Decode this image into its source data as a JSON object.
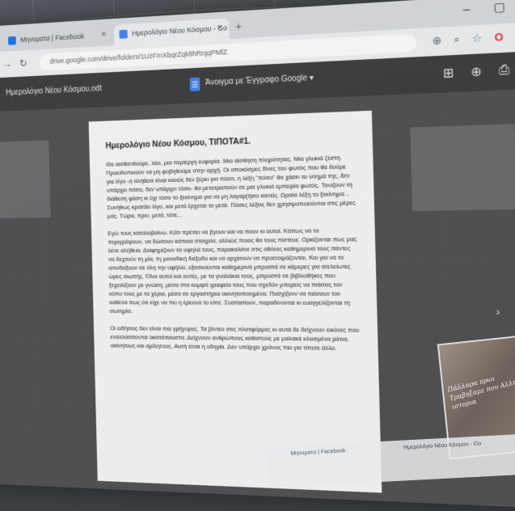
{
  "tabs": [
    {
      "label": "Μηνυματα | Facebook",
      "color": "#1877f2"
    },
    {
      "label": "Ημερολόγιο Νέου Κόσμου - Go",
      "color": "#4285f4"
    }
  ],
  "new_tab": "+",
  "window_controls": {
    "minimize": "–",
    "maximize": "▢",
    "close": "×"
  },
  "address_bar": {
    "url": "drive.google.com/drive/folders/1UzFmXbqrZqk8hRnjqPMlZ"
  },
  "viewer": {
    "back_icon": "←",
    "doc_name": "Ημερολόγιο Νέου Κόσμου.odt",
    "open_with": "Άνοιγμα με Έγγραφο Google",
    "open_with_arrow": "▾"
  },
  "document": {
    "title": "Ημερολόγιο Νέου Κόσμου, ΤΙΠΟΤΑ#1.",
    "paragraphs": [
      "Θα αισθανθούμε, λέει, μια περίεργη ευφορία. Μια αίσθηση πληρότητας. Μια γλυκιά ζέστη. Προειδοποιούν να μη φοβηθούμε στην αρχή. Οι αποκόσμες δίνες του φωτός που θα δούμε για λίγο -η αλήθεια είναι κανείς δεν ξέρει για πόσο, η λέξη \"πόσο\" θα χάσει το νόημά της, δεν υπάρχει πόσο, δεν υπάρχει τόσο- θα μετατραπούν σε μια γλυκιά εμπειρία φωτός. Τονίζουν τη διάθεση φάση κι όχι τόσο το ξεκίνημα για να μη λαγαρ(ήσει κανείς. Ωραία λέξη το ξεκίνημα... Συνήθως κρατάει λίγο, και μετά έρχεται το μετά. Πόσες λέξεις δεν χρησιμοποιούνται στις μέρες μας. Τώρα, πριν, μετά, τότε...",
      "Εγώ τους καταλαβαίνω. Κάτι πρέπει να βγουν και να πουν κι αυτοί. Κάπως να το περιγράψουν, να δώσουν κάποια στοιχεία, αλλιώς ποιος θα τους πίστευε. Ορκίζονται πως μας λένε αλήθεια. Διαφημίζουν τα υψηλά τους, παρακαλάνε στις οθόνες καθημερινά τους πάντες να δεχτούν τη μία, τη μοναδική διέξοδο και να αρχίσουν να προετοιμάζονται. Και για να το αποδείξουν σε όλη την υφήλιο, εξασκούνται καθημερινά μπροστά σε κάμερες για ατελείωτες ώρες σιωπής. Όλοι αυτοί και αυτές, με τα γυαλάκια τους, μπροστά σε βιβλιοθήκες που ξεχειλίζουν με γνώση, μέσα στα κομψά γραφεία τους που σχεδόν μπορείς να πιάσεις τον κόπο τους με τα χέρια, μέσα σε εργαστήρια ακινητοποιημένα. Ποσχίζονν να πείσουν τον καθένα πως ότι είχε να πει η έρευνα το είπε. Συστασίουν, παραδίνονται κι ευαγγελίζονται τη σωτηρία.",
      "Οι ειδήσεις δεν είναι πια γρήγορες. Τα βίντεο στις πλατφόρμες κι αυτά δε δείχνουν εικόνες που εναλλάσσονται ακατάπαυστα. Δείχνουν ανθρώπους καθιστούς με μαλακά κλεισμένα μάτια, ακίνητους και αμίλητους. Αυτή είναι η οδηγία. Δεν υπάρχει χρόνος πια για τίποτε άλλο."
    ]
  },
  "photo_caption": "Πάλλαρα πρωι Τραβηξαμε που Αλλη ιστορια"
}
